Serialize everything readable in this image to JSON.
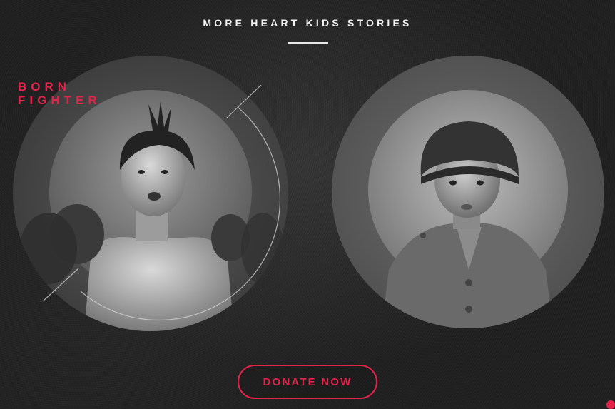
{
  "header": {
    "title": "MORE HEART KIDS STORIES"
  },
  "stories": [
    {
      "tag": "BORN\nFIGHTER",
      "image_alt": "Black-and-white portrait of a young boy wearing boxing gloves"
    },
    {
      "tag": "",
      "image_alt": "Black-and-white portrait of a toddler wearing a soldier helmet and uniform jacket"
    }
  ],
  "cta": {
    "donate_label": "DONATE NOW"
  },
  "colors": {
    "accent": "#e2234a",
    "background": "#202020",
    "text": "#f2f2f2"
  },
  "icons": {
    "corner_indicator": "dot-icon"
  }
}
